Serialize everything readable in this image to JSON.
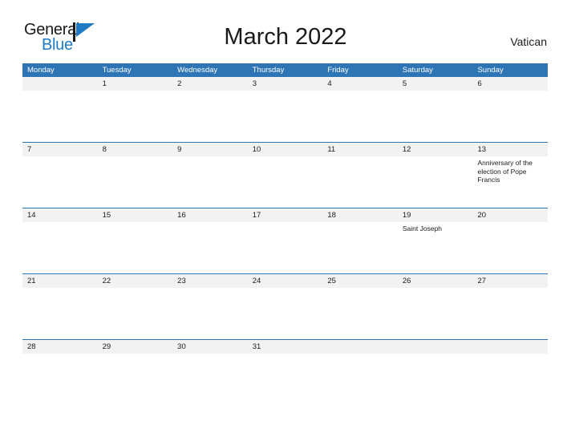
{
  "brand": {
    "name_part1": "General",
    "name_part2": "Blue",
    "flag_icon": "flag-triangle-icon",
    "accent_color": "#1f7ac4"
  },
  "header": {
    "title": "March 2022",
    "region": "Vatican"
  },
  "theme": {
    "header_blue": "#2e75b6",
    "band_gray": "#f2f2f2",
    "text_dark": "#1a1a1a"
  },
  "calendar": {
    "weekdays": [
      "Monday",
      "Tuesday",
      "Wednesday",
      "Thursday",
      "Friday",
      "Saturday",
      "Sunday"
    ],
    "weeks": [
      {
        "days": [
          {
            "number": "",
            "events": []
          },
          {
            "number": "1",
            "events": []
          },
          {
            "number": "2",
            "events": []
          },
          {
            "number": "3",
            "events": []
          },
          {
            "number": "4",
            "events": []
          },
          {
            "number": "5",
            "events": []
          },
          {
            "number": "6",
            "events": []
          }
        ]
      },
      {
        "days": [
          {
            "number": "7",
            "events": []
          },
          {
            "number": "8",
            "events": []
          },
          {
            "number": "9",
            "events": []
          },
          {
            "number": "10",
            "events": []
          },
          {
            "number": "11",
            "events": []
          },
          {
            "number": "12",
            "events": []
          },
          {
            "number": "13",
            "events": [
              "Anniversary of the election of Pope Francis"
            ]
          }
        ]
      },
      {
        "days": [
          {
            "number": "14",
            "events": []
          },
          {
            "number": "15",
            "events": []
          },
          {
            "number": "16",
            "events": []
          },
          {
            "number": "17",
            "events": []
          },
          {
            "number": "18",
            "events": []
          },
          {
            "number": "19",
            "events": [
              "Saint Joseph"
            ]
          },
          {
            "number": "20",
            "events": []
          }
        ]
      },
      {
        "days": [
          {
            "number": "21",
            "events": []
          },
          {
            "number": "22",
            "events": []
          },
          {
            "number": "23",
            "events": []
          },
          {
            "number": "24",
            "events": []
          },
          {
            "number": "25",
            "events": []
          },
          {
            "number": "26",
            "events": []
          },
          {
            "number": "27",
            "events": []
          }
        ]
      },
      {
        "days": [
          {
            "number": "28",
            "events": []
          },
          {
            "number": "29",
            "events": []
          },
          {
            "number": "30",
            "events": []
          },
          {
            "number": "31",
            "events": []
          },
          {
            "number": "",
            "events": []
          },
          {
            "number": "",
            "events": []
          },
          {
            "number": "",
            "events": []
          }
        ]
      }
    ]
  }
}
